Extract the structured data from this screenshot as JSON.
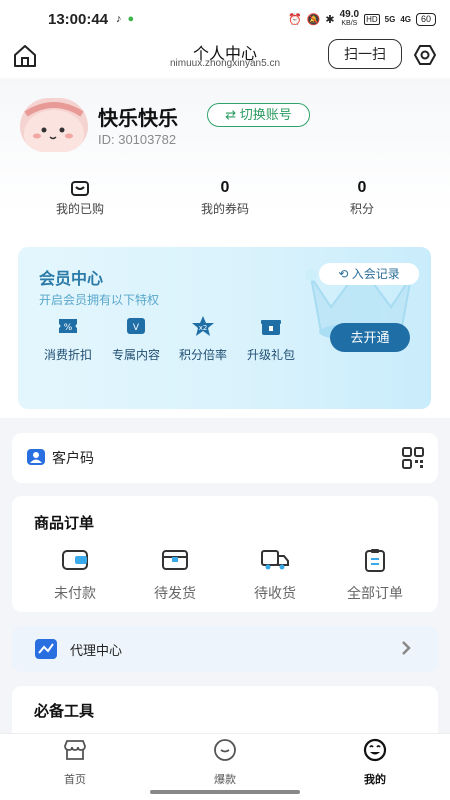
{
  "status_bar": {
    "time": "13:00:44",
    "net_speed": "49.0",
    "net_unit": "KB/S",
    "hd": "HD",
    "sig1": "5G",
    "sig2": "4G",
    "battery": "60"
  },
  "header": {
    "title": "个人中心",
    "subtitle": "nimuux.zhongxinyan5.cn",
    "scan_label": "扫一扫"
  },
  "profile": {
    "name": "快乐快乐",
    "switch_label": "切换账号",
    "id_text": "ID: 30103782"
  },
  "stats": [
    {
      "value": "",
      "label": "我的已购",
      "icon": "bag-icon"
    },
    {
      "value": "0",
      "label": "我的券码"
    },
    {
      "value": "0",
      "label": "积分"
    }
  ],
  "vip": {
    "title": "会员中心",
    "subtitle": "开启会员拥有以下特权",
    "record_label": "入会记录",
    "open_label": "去开通",
    "perks": [
      {
        "label": "消费折扣",
        "icon": "discount-icon"
      },
      {
        "label": "专属内容",
        "icon": "exclusive-icon"
      },
      {
        "label": "积分倍率",
        "icon": "points-multiplier-icon"
      },
      {
        "label": "升级礼包",
        "icon": "gift-icon"
      }
    ],
    "colors": {
      "accent": "#1f6fa6",
      "title": "#2b7aa8"
    }
  },
  "customer_code": {
    "label": "客户码"
  },
  "orders": {
    "title": "商品订单",
    "items": [
      {
        "label": "未付款",
        "icon": "wallet-icon"
      },
      {
        "label": "待发货",
        "icon": "package-icon"
      },
      {
        "label": "待收货",
        "icon": "truck-icon"
      },
      {
        "label": "全部订单",
        "icon": "clipboard-icon"
      }
    ]
  },
  "agent": {
    "label": "代理中心"
  },
  "tools": {
    "title": "必备工具"
  },
  "tabbar": [
    {
      "label": "首页",
      "icon": "store-icon",
      "active": false
    },
    {
      "label": "爆款",
      "icon": "hot-icon",
      "active": false
    },
    {
      "label": "我的",
      "icon": "profile-face-icon",
      "active": true
    }
  ]
}
